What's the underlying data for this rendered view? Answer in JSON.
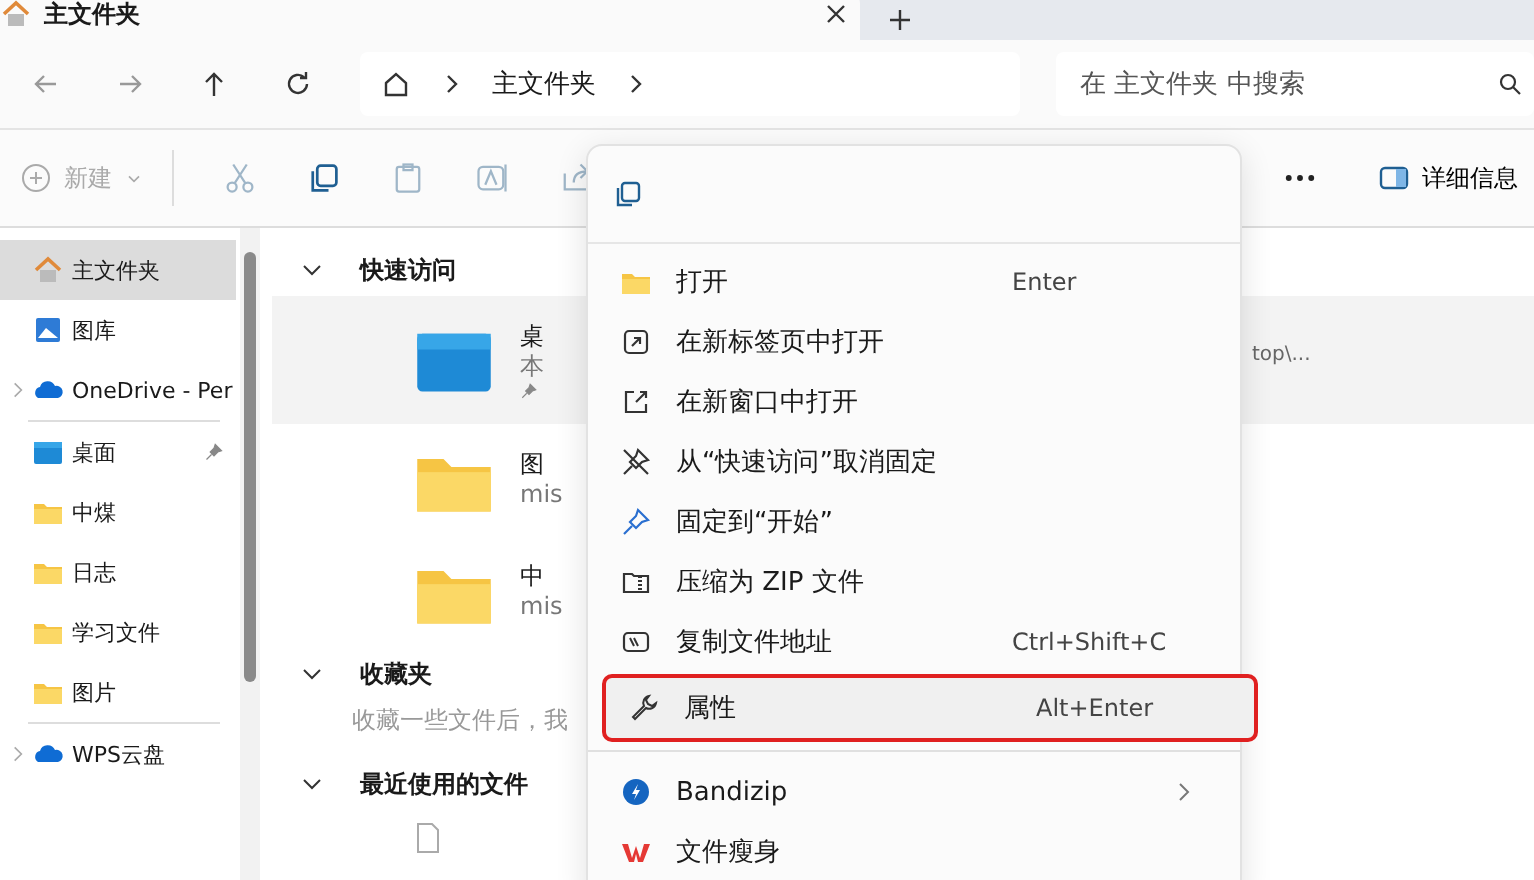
{
  "tabs": [
    {
      "label": "主文件夹",
      "selected": true
    }
  ],
  "address": {
    "crumbs": [
      "主文件夹"
    ]
  },
  "search": {
    "placeholder": "在 主文件夹 中搜索"
  },
  "toolbar": {
    "new_label": "新建",
    "new_disabled": true,
    "details_label": "详细信息"
  },
  "sidebar": {
    "groups": [
      {
        "items": [
          {
            "label": "主文件夹",
            "kind": "home",
            "selected": true,
            "pinned": false,
            "expandable": false
          },
          {
            "label": "图库",
            "kind": "gallery",
            "selected": false,
            "pinned": false,
            "expandable": false
          },
          {
            "label": "OneDrive - Per",
            "kind": "cloud",
            "selected": false,
            "pinned": false,
            "expandable": true
          }
        ]
      },
      {
        "items": [
          {
            "label": "桌面",
            "kind": "desktop",
            "selected": false,
            "pinned": true,
            "expandable": false
          },
          {
            "label": "中煤",
            "kind": "folder",
            "selected": false,
            "pinned": false,
            "expandable": false
          },
          {
            "label": "日志",
            "kind": "folder",
            "selected": false,
            "pinned": false,
            "expandable": false
          },
          {
            "label": "学习文件",
            "kind": "folder",
            "selected": false,
            "pinned": false,
            "expandable": false
          },
          {
            "label": "图片",
            "kind": "folder",
            "selected": false,
            "pinned": false,
            "expandable": false
          }
        ]
      },
      {
        "items": [
          {
            "label": "WPS云盘",
            "kind": "cloud",
            "selected": false,
            "pinned": false,
            "expandable": true
          }
        ]
      }
    ]
  },
  "quick_access": {
    "title": "快速访问",
    "items": [
      {
        "name": "桌",
        "detail": "本",
        "kind": "desktop",
        "selected": true,
        "pinned": true,
        "path_tail": "top\\..."
      },
      {
        "name": "图",
        "detail": "mis",
        "kind": "folder",
        "selected": false,
        "pinned": false
      },
      {
        "name": "中",
        "detail": "mis",
        "kind": "folder",
        "selected": false,
        "pinned": false
      }
    ]
  },
  "favorites": {
    "title": "收藏夹",
    "description": "收藏一些文件后，我"
  },
  "recent": {
    "title": "最近使用的文件"
  },
  "context_menu": {
    "items": [
      {
        "kind": "folder",
        "label": "打开",
        "shortcut": "Enter",
        "highlighted": false,
        "submenu": false
      },
      {
        "kind": "tab",
        "label": "在新标签页中打开",
        "highlighted": false,
        "submenu": false
      },
      {
        "kind": "window",
        "label": "在新窗口中打开",
        "highlighted": false,
        "submenu": false
      },
      {
        "kind": "unpin",
        "label": "从“快速访问”取消固定",
        "highlighted": false,
        "submenu": false
      },
      {
        "kind": "pin",
        "label": "固定到“开始”",
        "highlighted": false,
        "submenu": false
      },
      {
        "kind": "zip",
        "label": "压缩为 ZIP 文件",
        "highlighted": false,
        "submenu": false
      },
      {
        "kind": "path",
        "label": "复制文件地址",
        "shortcut": "Ctrl+Shift+C",
        "highlighted": false,
        "submenu": false
      },
      {
        "kind": "wrench",
        "label": "属性",
        "shortcut": "Alt+Enter",
        "highlighted": true,
        "submenu": false
      },
      {
        "kind": "separator"
      },
      {
        "kind": "bandizip",
        "label": "Bandizip",
        "highlighted": false,
        "submenu": true
      },
      {
        "kind": "wps",
        "label": "文件瘦身",
        "highlighted": false,
        "submenu": false
      }
    ]
  }
}
